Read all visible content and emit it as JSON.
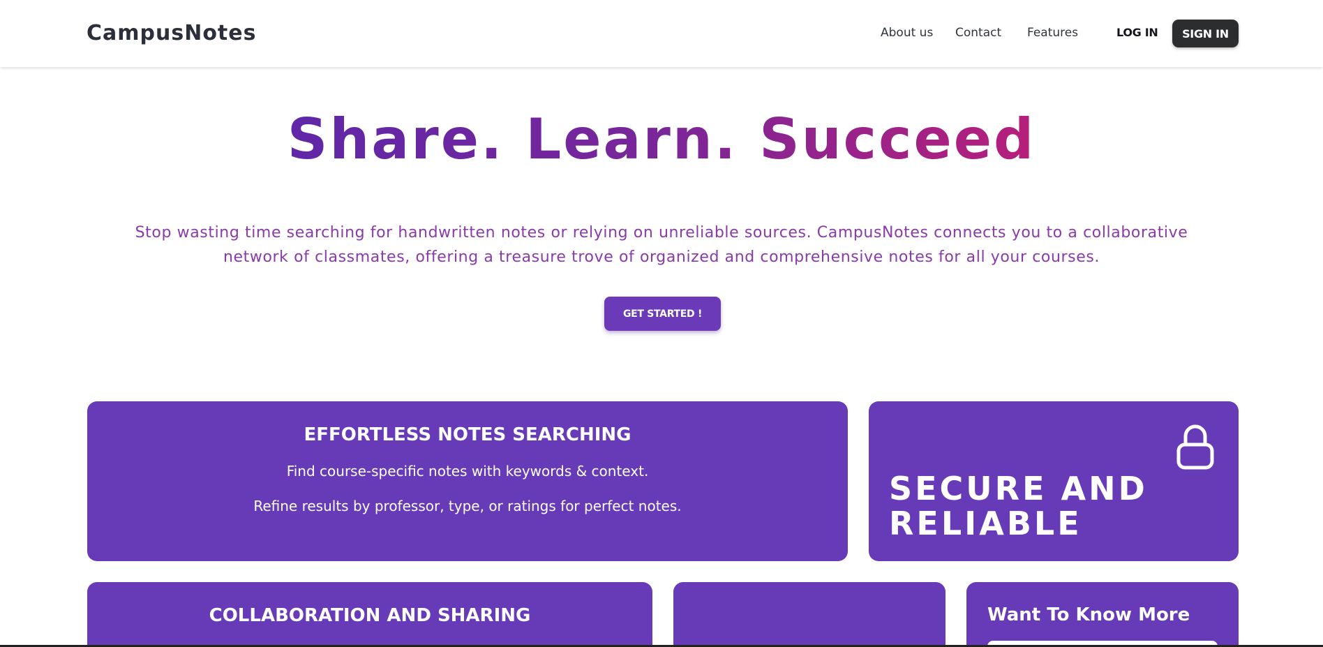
{
  "header": {
    "brand": "CampusNotes",
    "nav": {
      "about": "About us",
      "contact": "Contact",
      "features": "Features"
    },
    "login_label": "LOG IN",
    "signin_label": "SIGN IN"
  },
  "hero": {
    "title": "Share. Learn. Succeed",
    "subtitle": "Stop wasting time searching for handwritten notes or relying on unreliable sources. CampusNotes connects you to a collaborative network of classmates, offering a treasure trove of organized and comprehensive notes for all your courses.",
    "cta_label": "GET STARTED !"
  },
  "features": {
    "search": {
      "title": "EFFORTLESS NOTES SEARCHING",
      "line1": "Find course-specific notes with keywords & context.",
      "line2": "Refine results by professor, type, or ratings for perfect notes."
    },
    "secure": {
      "title_line1": "SECURE AND",
      "title_line2": "RELIABLE",
      "icon": "lock-icon"
    },
    "collab": {
      "title": "COLLABORATION AND SHARING"
    },
    "more": {
      "title": "Want To Know More",
      "input_placeholder": ""
    }
  },
  "colors": {
    "accent": "#673ab7",
    "cta": "#6a3ab8",
    "signin_bg": "#2c2d2f",
    "hero_gradient_start": "#5f27a8",
    "hero_gradient_end": "#b71f7b",
    "subtitle": "#8a3aa9"
  }
}
